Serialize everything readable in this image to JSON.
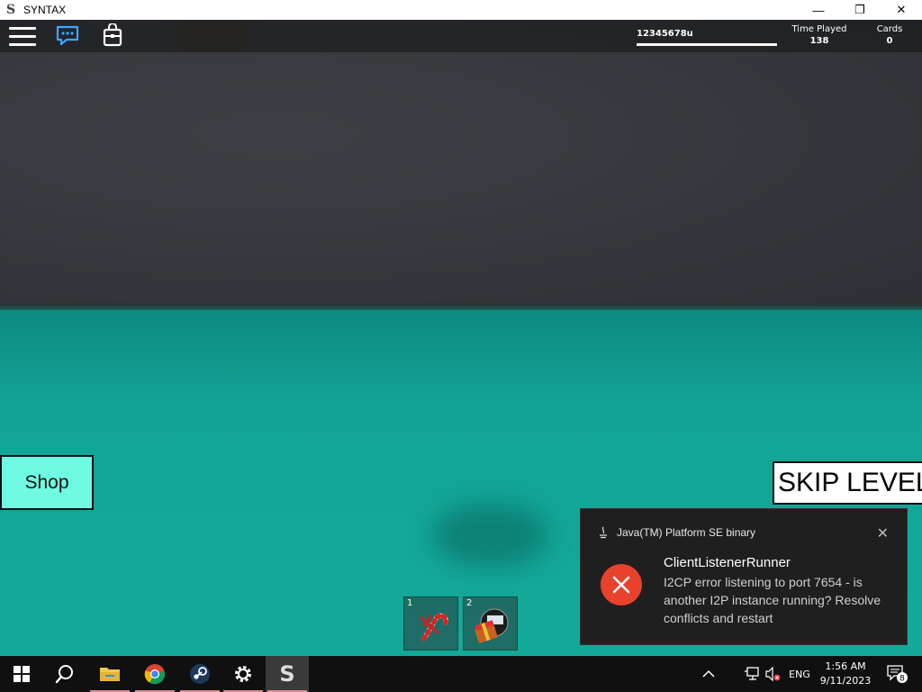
{
  "window": {
    "title": "SYNTAX",
    "app_icon": "S",
    "controls": {
      "minimize": "—",
      "restore": "❐",
      "close": "✕"
    }
  },
  "game": {
    "topbar": {
      "player_name": "12345678u",
      "time_played_label": "Time Played",
      "time_played_value": "138",
      "cards_label": "Cards",
      "cards_value": "0"
    },
    "shop_label": "Shop",
    "skip_label": "SKIP LEVEL",
    "hotbar": [
      {
        "slot": "1",
        "icon": "candy-cane-icon"
      },
      {
        "slot": "2",
        "icon": "gift-item-icon"
      }
    ],
    "colors": {
      "floor": "#13a999",
      "wall": "#34373b",
      "shop_bg": "#6ffbe1"
    }
  },
  "notification": {
    "app_name": "Java(TM) Platform SE binary",
    "title": "ClientListenerRunner",
    "body": "I2CP error listening to port 7654 - is another I2P instance running? Resolve conflicts and restart",
    "close": "✕",
    "icon": "error-icon",
    "accent": "#e8412c"
  },
  "taskbar": {
    "apps": [
      "start-icon",
      "search-icon",
      "file-explorer-icon",
      "chrome-icon",
      "steam-icon",
      "settings-icon",
      "syntax-icon"
    ],
    "syntax_glyph": "S",
    "language": "ENG",
    "time": "1:56 AM",
    "date": "9/11/2023",
    "notification_count": "8"
  }
}
